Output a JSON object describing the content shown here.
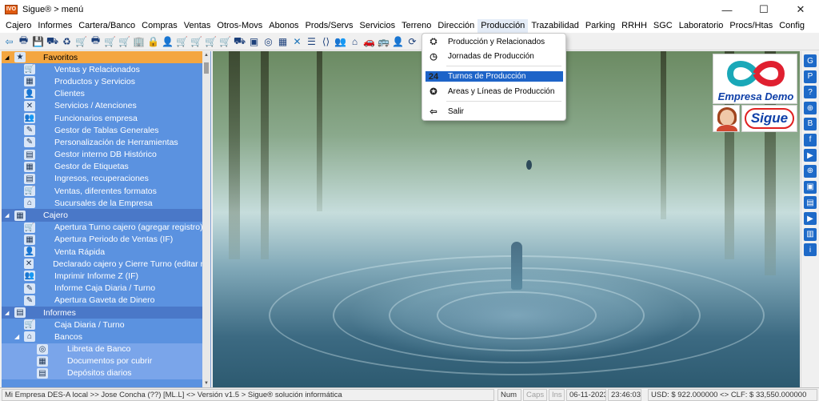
{
  "window": {
    "title": "Sigue® > menú",
    "app_icon": "IVO",
    "controls": {
      "minimize": "—",
      "maximize": "☐",
      "close": "✕"
    }
  },
  "menu": [
    "Cajero",
    "Informes",
    "Cartera/Banco",
    "Compras",
    "Ventas",
    "Otros-Movs",
    "Abonos",
    "Prods/Servs",
    "Servicios",
    "Terreno",
    "Dirección",
    "Producción",
    "Trazabilidad",
    "Parking",
    "RRHH",
    "SGC",
    "Laboratorio",
    "Procs/Htas",
    "Config"
  ],
  "active_menu": "Producción",
  "toolbar_icons": [
    "back-icon",
    "printer-icon",
    "disk-icon",
    "truck-icon",
    "recycle-icon",
    "cart-icon",
    "printer2-icon",
    "cart2-icon",
    "cart3-icon",
    "building-icon",
    "lock-icon",
    "person-icon",
    "cart4-icon",
    "cart5-icon",
    "cart6-icon",
    "cart7-icon",
    "truck2-icon",
    "box-icon",
    "coins-icon",
    "chart-icon",
    "tools-icon",
    "list-icon",
    "code-icon",
    "users-icon",
    "home-icon",
    "car-icon",
    "bus-icon",
    "person2-icon",
    "sync-icon",
    "gear-icon",
    "flag-icon",
    "qr-icon",
    "db-icon",
    "cross-icon"
  ],
  "dropdown": {
    "items": [
      {
        "label": "Producción y Relacionados",
        "icon": "⛭"
      },
      {
        "label": "Jornadas de Producción",
        "icon": "◷"
      },
      {
        "label": "Turnos de Producción",
        "icon": "24",
        "highlighted": true
      },
      {
        "label": "Areas y Líneas de Producción",
        "icon": "✪"
      },
      {
        "label": "Salir",
        "icon": "⇦"
      }
    ]
  },
  "tree": {
    "groups": [
      {
        "label": "Favoritos",
        "items": [
          "Ventas y Relacionados",
          "Productos y Servicios",
          "Clientes",
          "Servicios / Atenciones",
          "Funcionarios empresa",
          "Gestor de Tablas Generales",
          "Personalización de Herramientas",
          "Gestor interno DB Histórico",
          "Gestor de Etiquetas",
          "Ingresos, recuperaciones",
          "Ventas, diferentes formatos",
          "Sucursales de la Empresa"
        ]
      },
      {
        "label": "Cajero",
        "items": [
          "Apertura Turno cajero (agregar registro)",
          "Apertura Periodo de Ventas (IF)",
          "Venta Rápida",
          "Declarado cajero y Cierre Turno (editar r",
          "Imprimir Informe Z (IF)",
          "Informe Caja Diaria / Turno",
          "Apertura Gaveta de Dinero"
        ]
      },
      {
        "label": "Informes",
        "items": [
          "Caja Diaria / Turno"
        ],
        "subgroup": {
          "label": "Bancos",
          "items": [
            "Libreta de Banco",
            "Documentos por cubrir",
            "Depósitos diarios"
          ]
        }
      }
    ]
  },
  "brand": {
    "company": "Empresa Demo",
    "product": "Sigue"
  },
  "right_toolbar": [
    "G",
    "P",
    "?",
    "⊕",
    "B",
    "f",
    "▶",
    "⊕",
    "▣",
    "▤",
    "▶",
    "▥",
    "i"
  ],
  "status": {
    "left": "Mi Empresa DES-A local >> Jose Concha (??) [ML.L] <> Versión v1.5 > Sigue® solución informática",
    "num": "Num",
    "caps": "Caps",
    "ins": "Ins",
    "date": "06-11-2023",
    "time": "23:46:03",
    "currency": "USD: $ 922.000000 <> CLF: $ 33,550.000000"
  }
}
